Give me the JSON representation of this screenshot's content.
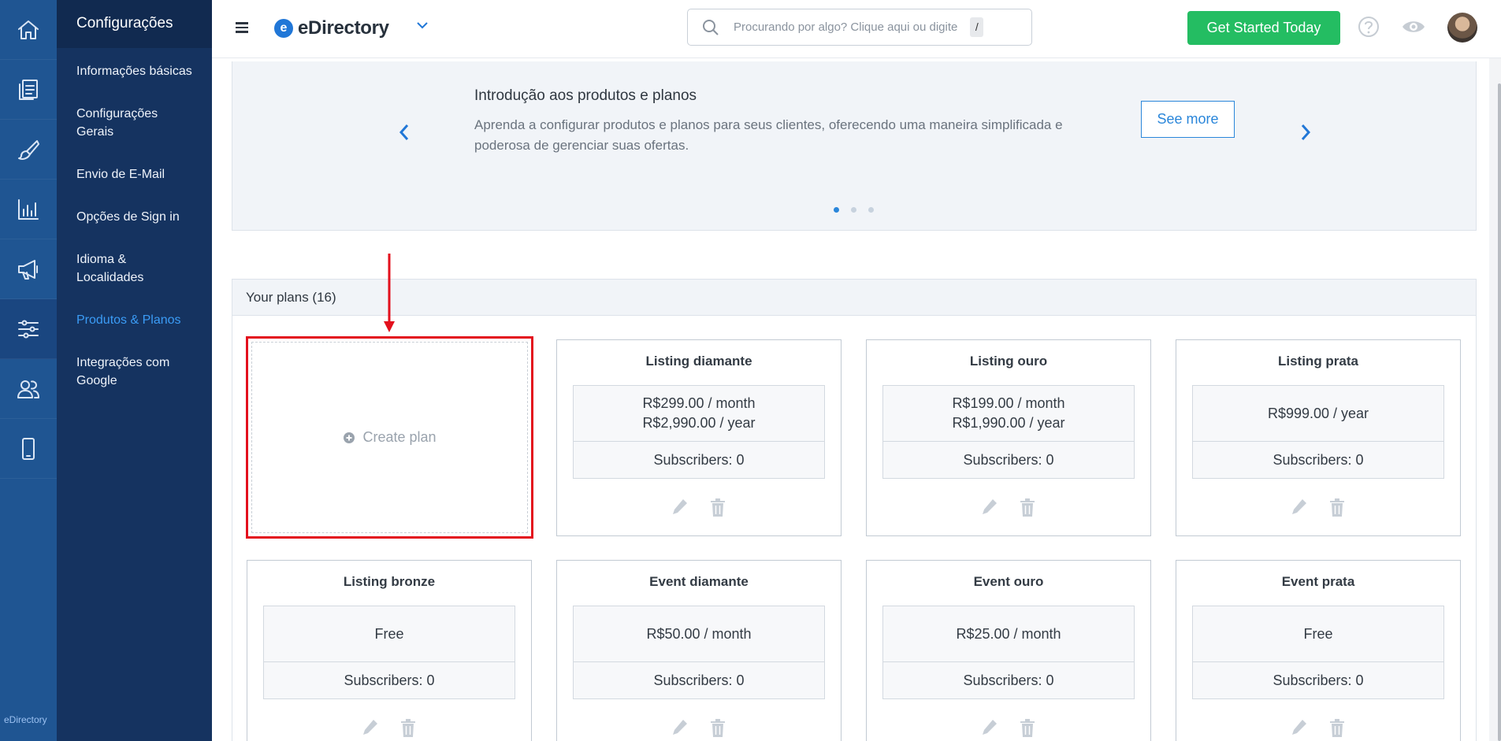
{
  "rail": {
    "icons": [
      "home-icon",
      "pages-icon",
      "brush-icon",
      "reports-icon",
      "megaphone-icon",
      "sliders-icon",
      "users-icon",
      "mobile-icon"
    ],
    "brand": "eDirectory"
  },
  "sidebar": {
    "title": "Configurações",
    "items": [
      {
        "label": "Informações básicas"
      },
      {
        "label": "Configurações Gerais"
      },
      {
        "label": "Envio de E-Mail"
      },
      {
        "label": "Opções de Sign in"
      },
      {
        "label": "Idioma & Localidades"
      },
      {
        "label": "Produtos & Planos",
        "active": true
      },
      {
        "label": "Integrações com Google"
      }
    ]
  },
  "header": {
    "logo_letter": "e",
    "logo_text": "eDirectory",
    "search_placeholder": "Procurando por algo? Clique aqui ou digite",
    "search_shortcut": "/",
    "cta_label": "Get Started Today",
    "icons": [
      "hamburger-menu-icon",
      "chevron-down-icon",
      "search-icon",
      "help-icon",
      "eye-icon",
      "user-avatar"
    ]
  },
  "intro": {
    "title": "Introdução aos produtos e planos",
    "description": "Aprenda a configurar produtos e planos para seus clientes, oferecendo uma maneira simplificada e poderosa de gerenciar suas ofertas.",
    "button_label": "See more",
    "slides": 3,
    "active_slide": 1
  },
  "plans": {
    "heading": "Your plans (16)",
    "create_label": "Create plan",
    "cards": [
      {
        "title": "Listing diamante",
        "prices": [
          "R$299.00 / month",
          "R$2,990.00 / year"
        ],
        "subscribers": "Subscribers: 0"
      },
      {
        "title": "Listing ouro",
        "prices": [
          "R$199.00 / month",
          "R$1,990.00 / year"
        ],
        "subscribers": "Subscribers: 0"
      },
      {
        "title": "Listing prata",
        "prices": [
          "R$999.00 / year"
        ],
        "subscribers": "Subscribers: 0"
      },
      {
        "title": "Listing bronze",
        "prices": [
          "Free"
        ],
        "subscribers": "Subscribers: 0"
      },
      {
        "title": "Event diamante",
        "prices": [
          "R$50.00 / month"
        ],
        "subscribers": "Subscribers: 0"
      },
      {
        "title": "Event ouro",
        "prices": [
          "R$25.00 / month"
        ],
        "subscribers": "Subscribers: 0"
      },
      {
        "title": "Event prata",
        "prices": [
          "Free"
        ],
        "subscribers": "Subscribers: 0"
      }
    ]
  },
  "colors": {
    "rail_bg": "#1f5592",
    "sidebar_bg": "#153360",
    "accent_blue": "#2a86da",
    "cta_green": "#24bd62",
    "annotation_red": "#e3101d"
  }
}
